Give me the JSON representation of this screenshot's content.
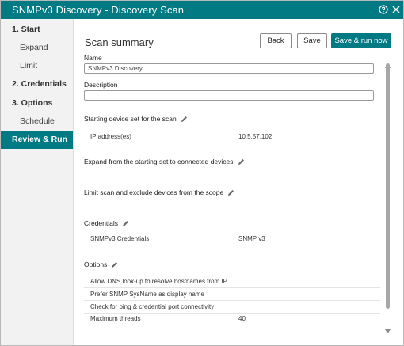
{
  "window": {
    "title": "SNMPv3 Discovery - Discovery Scan"
  },
  "titlebar_icons": [
    "help-icon",
    "close-icon"
  ],
  "sidebar": {
    "items": [
      {
        "label": "1. Start",
        "type": "step"
      },
      {
        "label": "Expand",
        "type": "sub"
      },
      {
        "label": "Limit",
        "type": "sub"
      },
      {
        "label": "2. Credentials",
        "type": "step"
      },
      {
        "label": "3. Options",
        "type": "step"
      },
      {
        "label": "Schedule",
        "type": "sub"
      },
      {
        "label": "Review & Run",
        "type": "step",
        "active": true
      }
    ]
  },
  "main": {
    "heading": "Scan summary",
    "buttons": {
      "back": "Back",
      "save": "Save",
      "save_run": "Save & run now"
    },
    "name_label": "Name",
    "name_value": "SNMPv3 Discovery",
    "description_label": "Description",
    "description_value": "",
    "starting_set": {
      "title": "Starting device set for the scan",
      "rows": [
        {
          "key": "IP address(es)",
          "value": "10.5.57.102"
        }
      ]
    },
    "expand_title": "Expand from the starting set to connected devices",
    "limit_title": "Limit scan and exclude devices from the scope",
    "credentials": {
      "title": "Credentials",
      "rows": [
        {
          "key": "SNMPv3 Credentials",
          "value": "SNMP v3"
        }
      ]
    },
    "options": {
      "title": "Options",
      "rows": [
        {
          "key": "Allow DNS look-up to resolve hostnames from IP",
          "value": ""
        },
        {
          "key": "Prefer SNMP SysName as display name",
          "value": ""
        },
        {
          "key": "Check for ping & credential port connectivity",
          "value": ""
        },
        {
          "key": "Maximum threads",
          "value": "40"
        }
      ]
    }
  },
  "colors": {
    "accent": "#017a83",
    "sidebar_bg": "#f2f2f2"
  }
}
